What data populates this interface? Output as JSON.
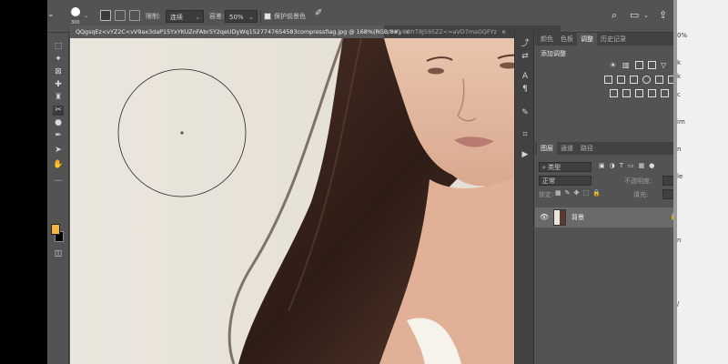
{
  "options_bar": {
    "brush_size": "300",
    "limits_label": "限制:",
    "limits_value": "连续",
    "tolerance_label": "容差:",
    "tolerance_value": "50%",
    "protect_fg_label": "保护前景色"
  },
  "document_tabs": [
    {
      "label": "QQgsqEz<vYZ2C<vV9ax3daP15YxYKUZnFAbr5Y2qeUDyWq1527747654583compressflag.jpg @ 168%(RGB/8#)",
      "close": "×",
      "active": true
    },
    {
      "label": "YXy8OfrT8J595ZZ<=aVD7maGQFYz",
      "close": "×",
      "active": false
    }
  ],
  "panels": {
    "top_tabs": [
      "颜色",
      "色板",
      "调整",
      "历史记录"
    ],
    "adjust_header": "添加调整",
    "layers_tabs": [
      "图层",
      "通道",
      "路径"
    ],
    "kind_placeholder": "类型",
    "blend_mode": "正常",
    "opacity_label": "不透明度:",
    "lock_label": "锁定:",
    "fill_label": "填充:",
    "layer_name": "背景"
  },
  "right_edge_text": [
    "0%",
    "k",
    "k",
    "c",
    "im",
    "n",
    "le",
    "n",
    "/"
  ]
}
